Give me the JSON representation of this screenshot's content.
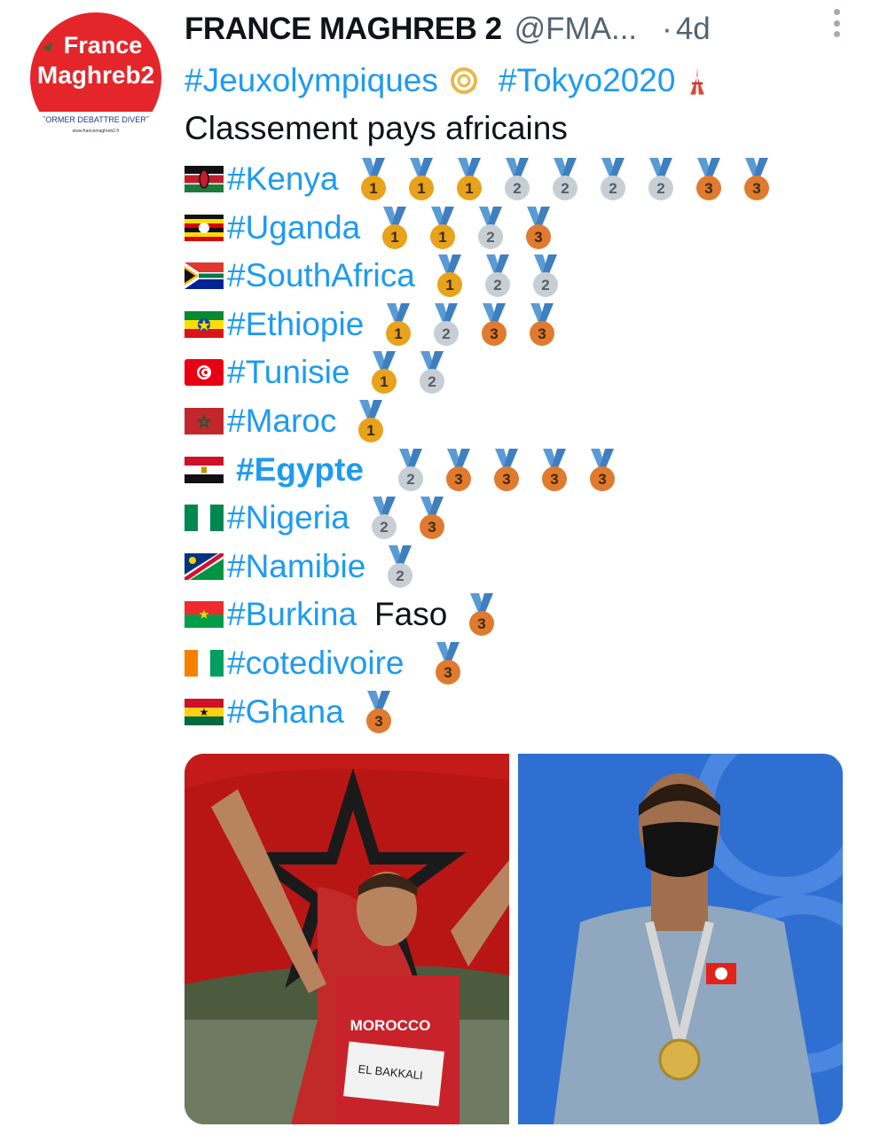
{
  "tweet": {
    "author_name": "FRANCE MAGHREB 2",
    "handle": "@FMA...",
    "dot": "·",
    "time": "4d",
    "avatar_text_line1": "France",
    "avatar_text_line2": "Maghreb2",
    "avatar_banner": "FORMER DEBATTRE DIVERT",
    "avatar_url_text": "www.francemaghreb2.fr",
    "hashtag1": "#Jeuxolympiques",
    "hashtag2": "#Tokyo2020",
    "subtitle": "Classement pays africains",
    "rows": [
      {
        "country": "#Kenya",
        "flag": "kenya",
        "medals": [
          1,
          1,
          1,
          2,
          2,
          2,
          2,
          3,
          3
        ]
      },
      {
        "country": "#Uganda",
        "flag": "uganda",
        "medals": [
          1,
          1,
          2,
          3
        ]
      },
      {
        "country": "#SouthAfrica",
        "flag": "southafrica",
        "medals": [
          1,
          2,
          2
        ]
      },
      {
        "country": "#Ethiopie",
        "flag": "ethiopia",
        "medals": [
          1,
          2,
          3,
          3
        ]
      },
      {
        "country": "#Tunisie",
        "flag": "tunisia",
        "medals": [
          1,
          2
        ]
      },
      {
        "country": "#Maroc",
        "flag": "morocco",
        "medals": [
          1
        ]
      },
      {
        "country": "#Egypte",
        "flag": "egypt",
        "medals": [
          2,
          3,
          3,
          3,
          3
        ]
      },
      {
        "country": "#Nigeria",
        "flag": "nigeria",
        "medals": [
          2,
          3
        ]
      },
      {
        "country": "#Namibie",
        "flag": "namibia",
        "medals": [
          2
        ]
      },
      {
        "country": "#Burkina",
        "suffix": "Faso",
        "flag": "burkina",
        "medals": [
          3
        ]
      },
      {
        "country": "#cotedivoire",
        "flag": "ivorycoast",
        "medals": [
          3
        ]
      },
      {
        "country": "#Ghana",
        "flag": "ghana",
        "medals": [
          3
        ]
      }
    ],
    "photo_left_text1": "MOROCCO",
    "photo_left_text2": "EL BAKKALI",
    "colors": {
      "link": "#1d9bf0",
      "gold": "#e8a21b",
      "silver": "#c7ced4",
      "bronze": "#e07a2e",
      "ribbon": "#5b9bd5"
    }
  }
}
